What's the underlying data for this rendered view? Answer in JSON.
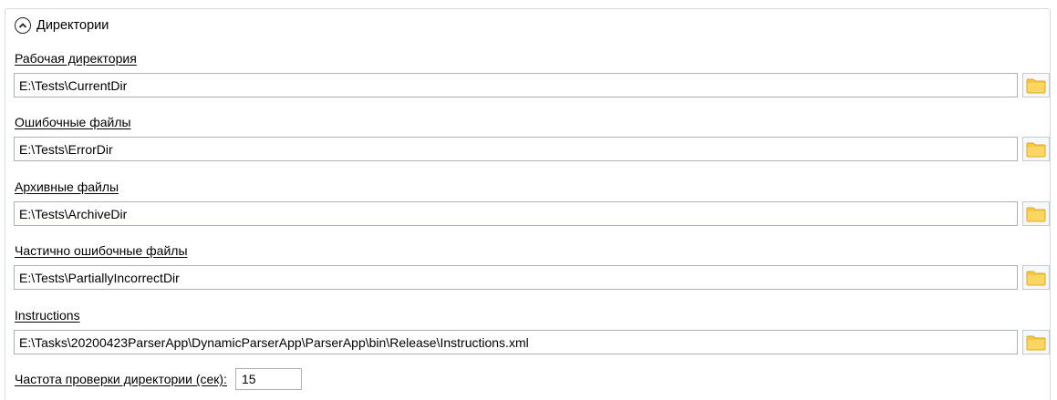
{
  "section": {
    "title": "Директории",
    "collapse_icon": "chevron-up-circle-icon"
  },
  "fields": [
    {
      "label": "Рабочая директория",
      "value": "E:\\Tests\\CurrentDir"
    },
    {
      "label": "Ошибочные файлы",
      "value": "E:\\Tests\\ErrorDir"
    },
    {
      "label": "Архивные файлы",
      "value": "E:\\Tests\\ArchiveDir"
    },
    {
      "label": "Частично ошибочные файлы",
      "value": "E:\\Tests\\PartiallyIncorrectDir"
    },
    {
      "label": "Instructions",
      "value": "E:\\Tasks\\20200423ParserApp\\DynamicParserApp\\ParserApp\\bin\\Release\\Instructions.xml"
    }
  ],
  "frequency": {
    "label": "Частота проверки директории (сек):",
    "value": "15"
  },
  "colors": {
    "folder_icon": "#f6c843",
    "border": "#a9b1bb"
  }
}
